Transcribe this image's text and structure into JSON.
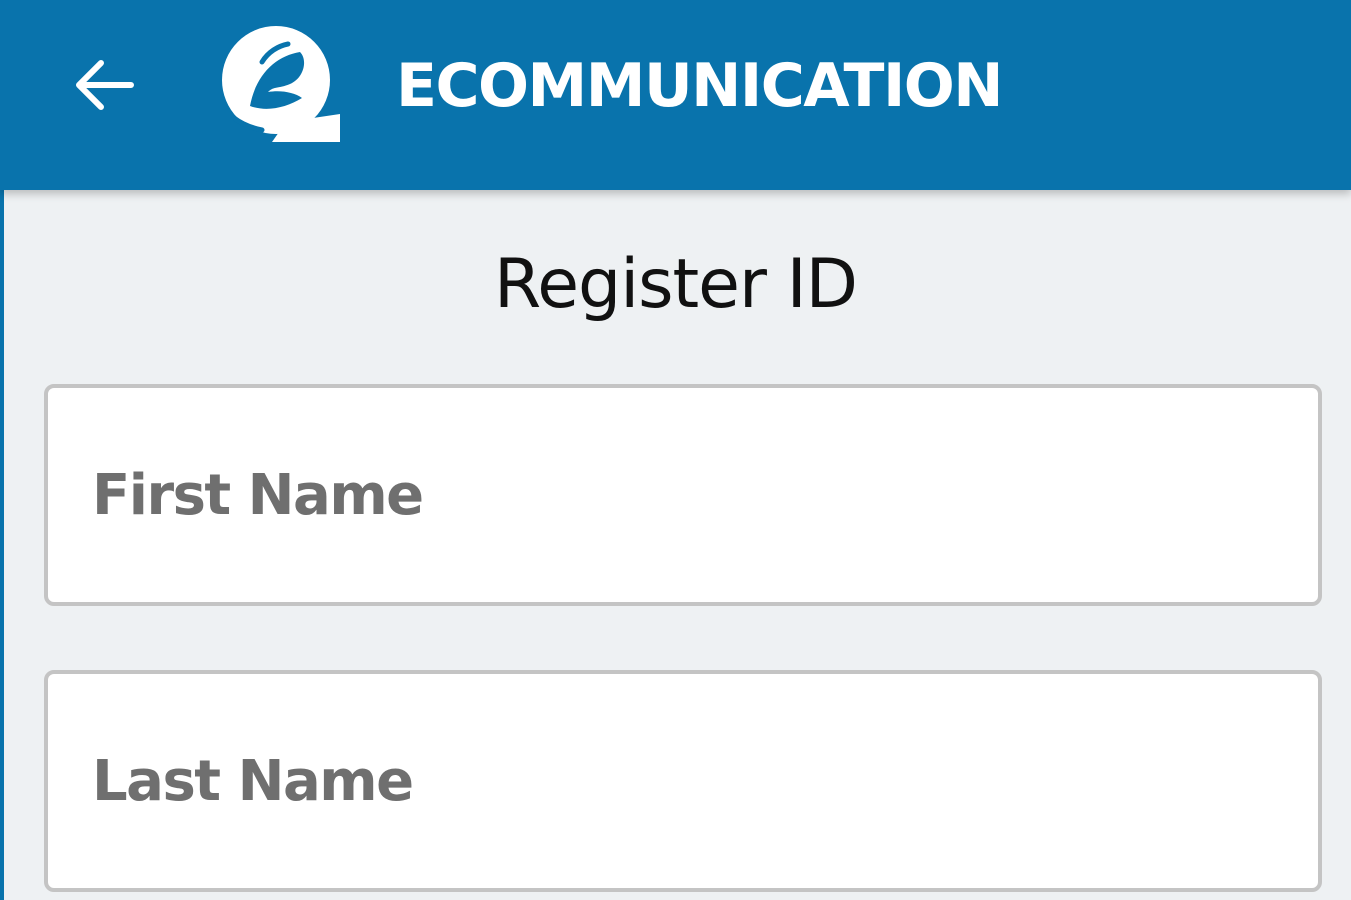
{
  "app_bar": {
    "title": "ECOMMUNICATION",
    "back_icon": "arrow-left-icon",
    "logo_icon": "ecommunication-logo-icon"
  },
  "page": {
    "title": "Register ID"
  },
  "form": {
    "first_name": {
      "value": "",
      "placeholder": "First Name"
    },
    "last_name": {
      "value": "",
      "placeholder": "Last Name"
    }
  },
  "colors": {
    "primary": "#0973ac",
    "background": "#eef1f3",
    "field_border": "#c4c4c4",
    "placeholder": "#6f6f6f"
  }
}
